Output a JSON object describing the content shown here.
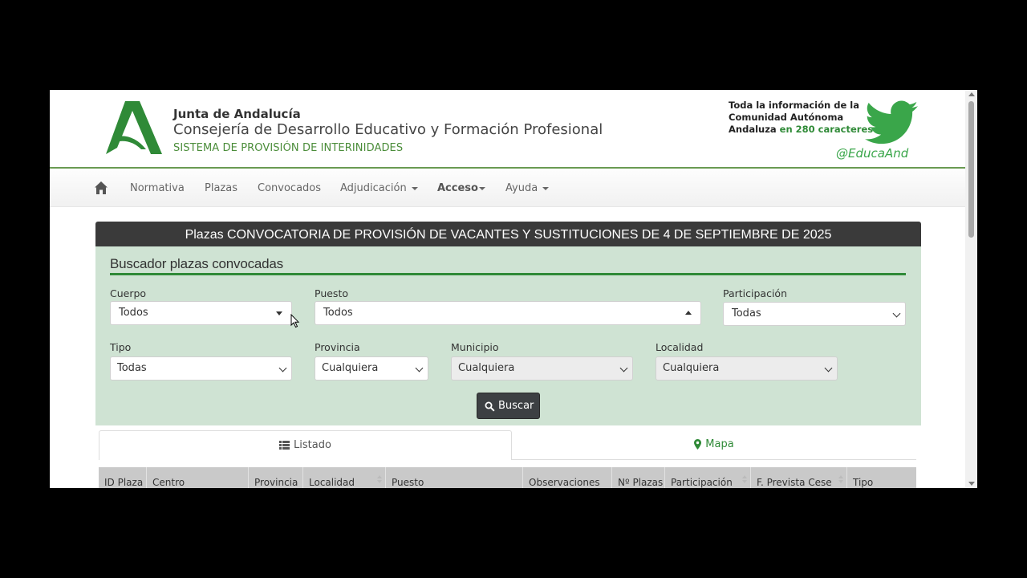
{
  "header": {
    "org_name": "Junta de Andalucía",
    "department": "Consejería de Desarrollo Educativo y Formación Profesional",
    "system": "SISTEMA DE PROVISIÓN DE INTERINIDADES",
    "promo_line1": "Toda la información de la",
    "promo_line2": "Comunidad Autónoma",
    "promo_line3a": "Andaluza ",
    "promo_line3b": "en 280 caracteres",
    "twitter_handle": "@EducaAnd",
    "brand_color": "#2f8a37"
  },
  "nav": {
    "home_icon": "home-icon",
    "items": [
      "Normativa",
      "Plazas",
      "Convocados",
      "Adjudicación",
      "Acceso",
      "Ayuda"
    ]
  },
  "panel": {
    "heading": "Plazas CONVOCATORIA DE PROVISIÓN DE VACANTES Y SUSTITUCIONES DE 4 DE SEPTIEMBRE DE 2025",
    "search_title": "Buscador plazas convocadas"
  },
  "filters": {
    "cuerpo": {
      "label": "Cuerpo",
      "value": "Todos"
    },
    "puesto": {
      "label": "Puesto",
      "value": "Todos"
    },
    "participacion": {
      "label": "Participación",
      "value": "Todas"
    },
    "tipo": {
      "label": "Tipo",
      "value": "Todas"
    },
    "provincia": {
      "label": "Provincia",
      "value": "Cualquiera"
    },
    "municipio": {
      "label": "Municipio",
      "value": "Cualquiera"
    },
    "localidad": {
      "label": "Localidad",
      "value": "Cualquiera"
    }
  },
  "search_button": "Buscar",
  "tabs": {
    "listado": "Listado",
    "mapa": "Mapa"
  },
  "table": {
    "columns": [
      "ID Plaza",
      "Centro",
      "Provincia",
      "Localidad",
      "Puesto",
      "Observaciones",
      "Nº Plazas",
      "Participación",
      "F. Prevista Cese",
      "Tipo"
    ]
  }
}
